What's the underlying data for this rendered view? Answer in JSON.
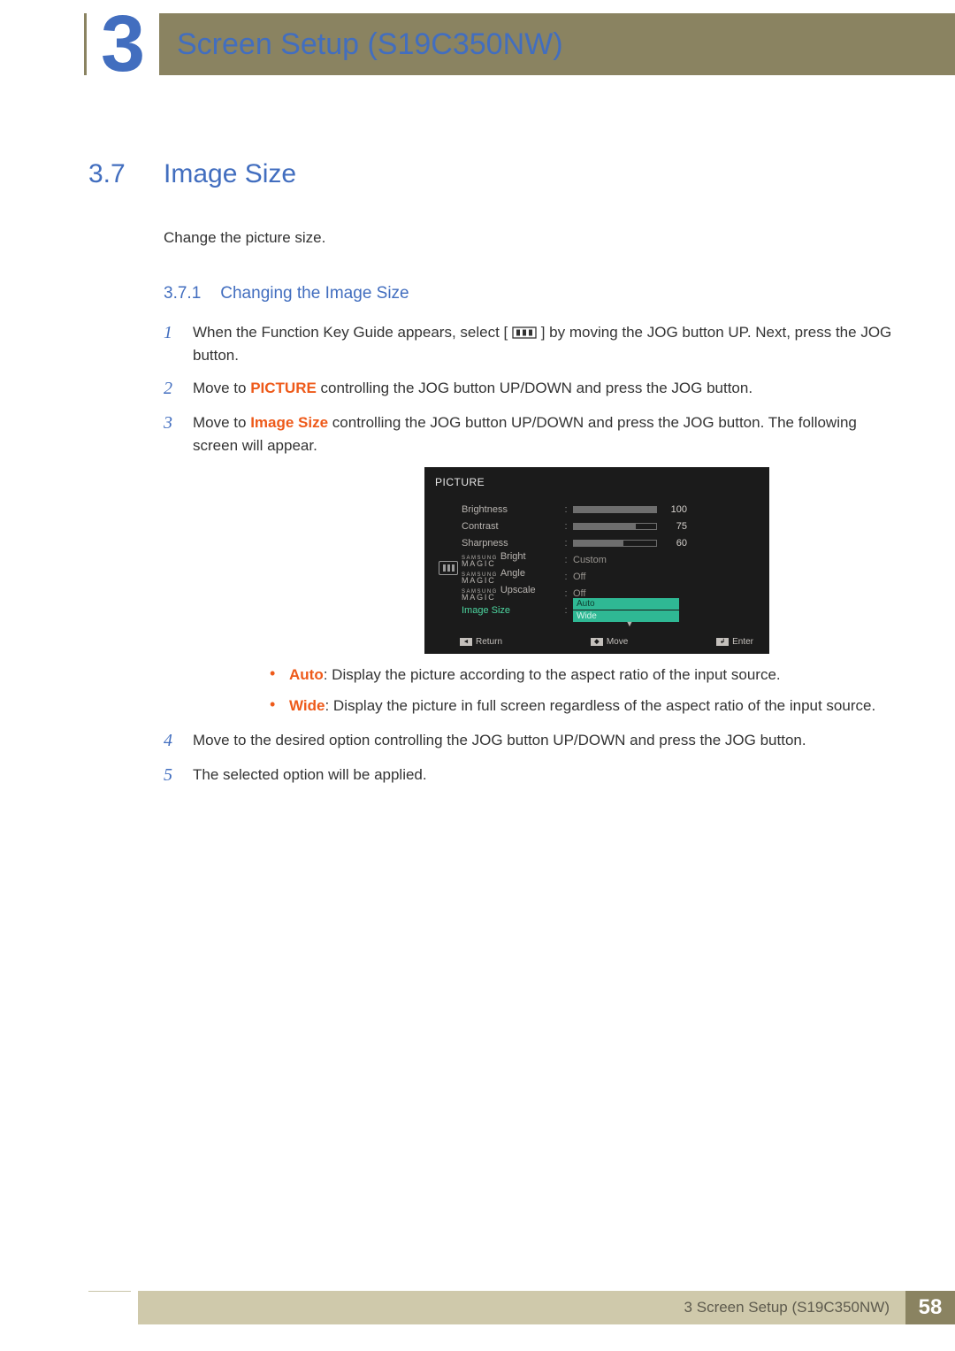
{
  "chapter": {
    "number": "3",
    "title": "Screen Setup (S19C350NW)"
  },
  "section": {
    "number": "3.7",
    "title": "Image Size",
    "intro": "Change the picture size."
  },
  "subsection": {
    "number": "3.7.1",
    "title": "Changing the Image Size"
  },
  "steps": {
    "s1": {
      "num": "1",
      "pre": "When the Function Key Guide appears, select [",
      "post": "] by moving the JOG button UP. Next, press the JOG button."
    },
    "s2": {
      "num": "2",
      "pre": "Move to ",
      "orange": "PICTURE",
      "post": " controlling the JOG button UP/DOWN and press the JOG button."
    },
    "s3": {
      "num": "3",
      "pre": "Move to ",
      "orange": "Image Size",
      "post": " controlling the JOG button UP/DOWN and press the JOG button. The following screen will appear."
    },
    "s4": {
      "num": "4",
      "text": "Move to the desired option controlling the JOG button UP/DOWN and press the JOG button."
    },
    "s5": {
      "num": "5",
      "text": "The selected option will be applied."
    }
  },
  "osd": {
    "title": "PICTURE",
    "rows": {
      "brightness": {
        "label": "Brightness",
        "value": 100,
        "pct": 100
      },
      "contrast": {
        "label": "Contrast",
        "value": 75,
        "pct": 75
      },
      "sharpness": {
        "label": "Sharpness",
        "value": 60,
        "pct": 60
      },
      "magic_bright": {
        "brand_top": "SAMSUNG",
        "brand_bot": "MAGIC",
        "suffix": "Bright",
        "value": "Custom"
      },
      "magic_angle": {
        "brand_top": "SAMSUNG",
        "brand_bot": "MAGIC",
        "suffix": "Angle",
        "value": "Off"
      },
      "magic_upscale": {
        "brand_top": "SAMSUNG",
        "brand_bot": "MAGIC",
        "suffix": "Upscale",
        "value": "Off"
      },
      "image_size": {
        "label": "Image Size",
        "opt1": "Auto",
        "opt2": "Wide"
      }
    },
    "footer": {
      "return": "Return",
      "move": "Move",
      "enter": "Enter"
    }
  },
  "bullets": {
    "auto": {
      "label": "Auto",
      "text": ": Display the picture according to the aspect ratio of the input source."
    },
    "wide": {
      "label": "Wide",
      "text": ": Display the picture in full screen regardless of the aspect ratio of the input source."
    }
  },
  "footer": {
    "label": "3 Screen Setup (S19C350NW)",
    "page": "58"
  }
}
